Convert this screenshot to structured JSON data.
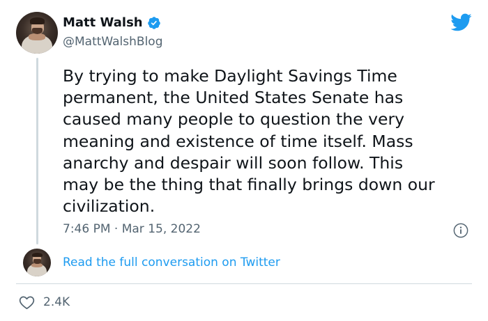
{
  "author": {
    "name": "Matt Walsh",
    "handle": "@MattWalshBlog",
    "verified": true
  },
  "tweet": {
    "text": "By trying to make Daylight Savings Time\npermanent, the United States Senate has\ncaused many people to question the very\nmeaning and existence of time itself. Mass\nanarchy and despair will soon follow. This\nmay be the thing that finally brings down our\ncivilization.",
    "timestamp": "7:46 PM · Mar 15, 2022"
  },
  "conversation_link": "Read the full conversation on Twitter",
  "likes": {
    "count": "2.4K"
  },
  "icons": {
    "logo": "twitter-bird-icon",
    "verified": "verified-badge-icon",
    "info": "info-icon",
    "like": "heart-icon"
  },
  "colors": {
    "brand_blue": "#1d9bf0",
    "text_primary": "#0f1419",
    "text_secondary": "#536471",
    "divider": "#cfd9de"
  }
}
